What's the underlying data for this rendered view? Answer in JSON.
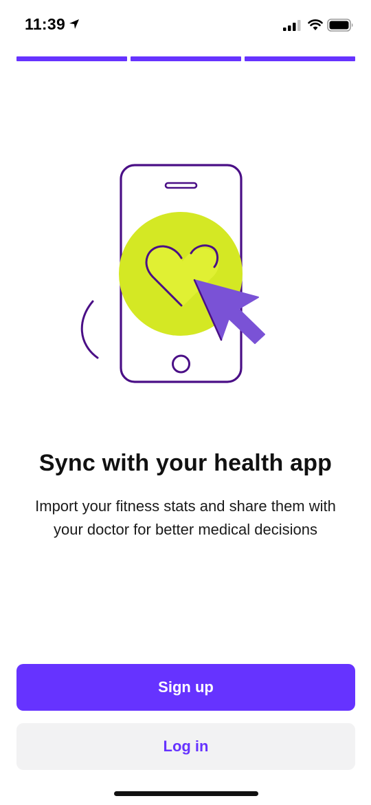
{
  "status_bar": {
    "time": "11:39",
    "icons": [
      "location-arrow-icon",
      "cellular-signal-icon",
      "wifi-icon",
      "battery-icon"
    ]
  },
  "progress": {
    "total_steps": 3,
    "completed_steps": 3,
    "active_color": "#6633ff"
  },
  "illustration": {
    "description_icons": [
      "phone-icon",
      "heart-icon",
      "cursor-arrow-icon"
    ],
    "colors": {
      "outline": "#4a0f86",
      "circle": "#d4e824",
      "cursor": "#7a52d6"
    }
  },
  "onboarding": {
    "title": "Sync with your health app",
    "body": "Import your fitness stats and share them with your doctor for better medical decisions"
  },
  "actions": {
    "signup_label": "Sign up",
    "login_label": "Log in"
  },
  "colors": {
    "primary": "#6633ff",
    "secondary_bg": "#f2f2f3"
  }
}
